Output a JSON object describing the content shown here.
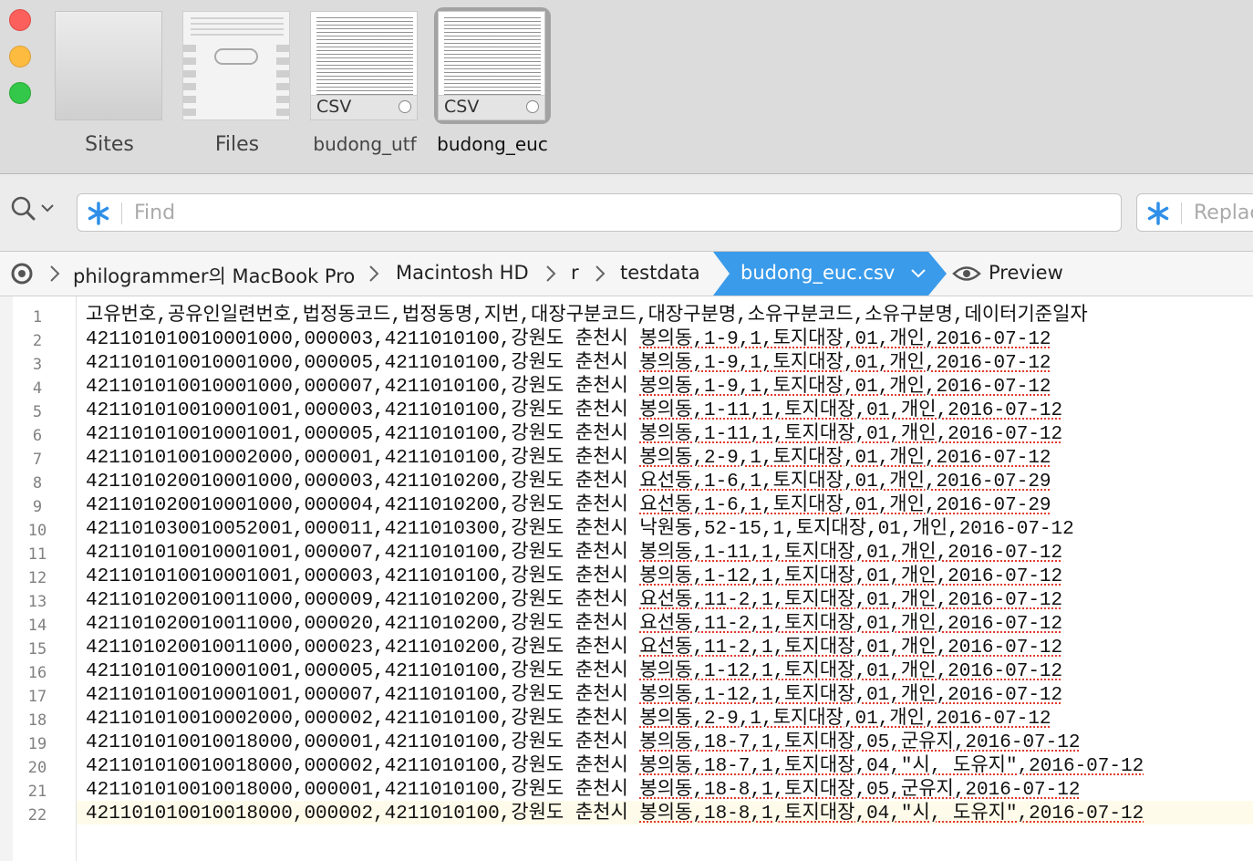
{
  "tabs": [
    {
      "label": "Sites"
    },
    {
      "label": "Files"
    },
    {
      "label": "budong_utf",
      "badge": "CSV"
    },
    {
      "label": "budong_euc",
      "badge": "CSV"
    }
  ],
  "find": {
    "placeholder": "Find"
  },
  "replace": {
    "placeholder": "Replace"
  },
  "path": {
    "items": [
      "philogrammer의 MacBook Pro",
      "Macintosh HD",
      "r",
      "testdata"
    ],
    "active": "budong_euc.csv",
    "preview": "Preview"
  },
  "editor": {
    "line_numbers": [
      "1",
      "2",
      "3",
      "4",
      "5",
      "6",
      "7",
      "8",
      "9",
      "10",
      "11",
      "12",
      "13",
      "14",
      "15",
      "16",
      "17",
      "18",
      "19",
      "20",
      "21",
      "22"
    ],
    "lines": [
      {
        "a": "고유번호,공유인일련번호,법정동코드,법정동명,지번,대장구분코드,대장구분명,소유구분코드,소유구분명,데이터기준일자",
        "b": ""
      },
      {
        "a": "421101010010001000,000003,4211010100,강원도 춘천시 ",
        "b": "봉의동,1-9,1,토지대장,01,개인,2016-07-12"
      },
      {
        "a": "421101010010001000,000005,4211010100,강원도 춘천시 ",
        "b": "봉의동,1-9,1,토지대장,01,개인,2016-07-12"
      },
      {
        "a": "421101010010001000,000007,4211010100,강원도 춘천시 ",
        "b": "봉의동,1-9,1,토지대장,01,개인,2016-07-12"
      },
      {
        "a": "421101010010001001,000003,4211010100,강원도 춘천시 ",
        "b": "봉의동,1-11,1,토지대장,01,개인,2016-07-12"
      },
      {
        "a": "421101010010001001,000005,4211010100,강원도 춘천시 ",
        "b": "봉의동,1-11,1,토지대장,01,개인,2016-07-12"
      },
      {
        "a": "421101010010002000,000001,4211010100,강원도 춘천시 ",
        "b": "봉의동,2-9,1,토지대장,01,개인,2016-07-12"
      },
      {
        "a": "421101020010001000,000003,4211010200,강원도 춘천시 ",
        "b": "요선동,1-6,1,토지대장,01,개인,2016-07-29"
      },
      {
        "a": "421101020010001000,000004,4211010200,강원도 춘천시 ",
        "b": "요선동,1-6,1,토지대장,01,개인,2016-07-29"
      },
      {
        "a": "421101030010052001,000011,4211010300,강원도 춘천시 낙원동,52-15,1,토지대장,01,개인,2016-07-12",
        "b": ""
      },
      {
        "a": "421101010010001001,000007,4211010100,강원도 춘천시 ",
        "b": "봉의동,1-11,1,토지대장,01,개인,2016-07-12"
      },
      {
        "a": "421101010010001001,000003,4211010100,강원도 춘천시 ",
        "b": "봉의동,1-12,1,토지대장,01,개인,2016-07-12"
      },
      {
        "a": "421101020010011000,000009,4211010200,강원도 춘천시 ",
        "b": "요선동,11-2,1,토지대장,01,개인,2016-07-12"
      },
      {
        "a": "421101020010011000,000020,4211010200,강원도 춘천시 ",
        "b": "요선동,11-2,1,토지대장,01,개인,2016-07-12"
      },
      {
        "a": "421101020010011000,000023,4211010200,강원도 춘천시 ",
        "b": "요선동,11-2,1,토지대장,01,개인,2016-07-12"
      },
      {
        "a": "421101010010001001,000005,4211010100,강원도 춘천시 ",
        "b": "봉의동,1-12,1,토지대장,01,개인,2016-07-12"
      },
      {
        "a": "421101010010001001,000007,4211010100,강원도 춘천시 ",
        "b": "봉의동,1-12,1,토지대장,01,개인,2016-07-12"
      },
      {
        "a": "421101010010002000,000002,4211010100,강원도 춘천시 ",
        "b": "봉의동,2-9,1,토지대장,01,개인,2016-07-12"
      },
      {
        "a": "421101010010018000,000001,4211010100,강원도 춘천시 ",
        "b": "봉의동,18-7,1,토지대장,05,군유지,2016-07-12"
      },
      {
        "a": "421101010010018000,000002,4211010100,강원도 춘천시 ",
        "b": "봉의동,18-7,1,토지대장,04,\"시, 도유지\",2016-07-12"
      },
      {
        "a": "421101010010018000,000001,4211010100,강원도 춘천시 ",
        "b": "봉의동,18-8,1,토지대장,05,군유지,2016-07-12"
      },
      {
        "a": "421101010010018000,000002,4211010100,강원도 춘천시 ",
        "b": "봉의동,18-8,1,토지대장,04,\"시, 도유지\",2016-07-12"
      }
    ]
  },
  "colors": {
    "accent": "#3a9bea",
    "misspelling": "#e23b2e"
  }
}
